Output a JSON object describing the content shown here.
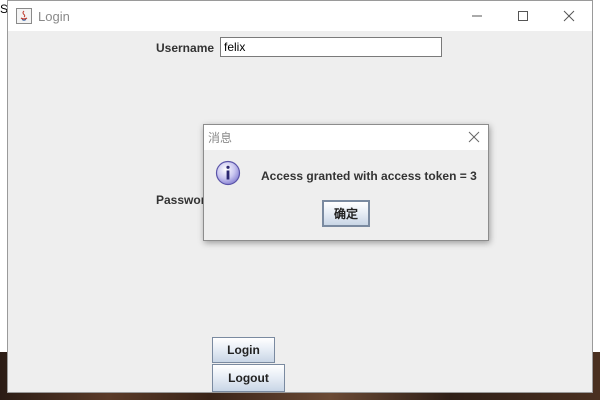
{
  "desktop": {
    "stub_text": "S"
  },
  "window": {
    "title": "Login",
    "icon": "java-icon",
    "controls": {
      "minimize": "minimize-icon",
      "maximize": "maximize-icon",
      "close": "close-icon"
    }
  },
  "form": {
    "username_label": "Username",
    "username_value": "felix",
    "password_label": "Password",
    "login_button": "Login",
    "logout_button": "Logout"
  },
  "dialog": {
    "title": "消息",
    "icon": "info-icon",
    "message": "Access granted with access token = 3",
    "ok_button": "确定"
  }
}
